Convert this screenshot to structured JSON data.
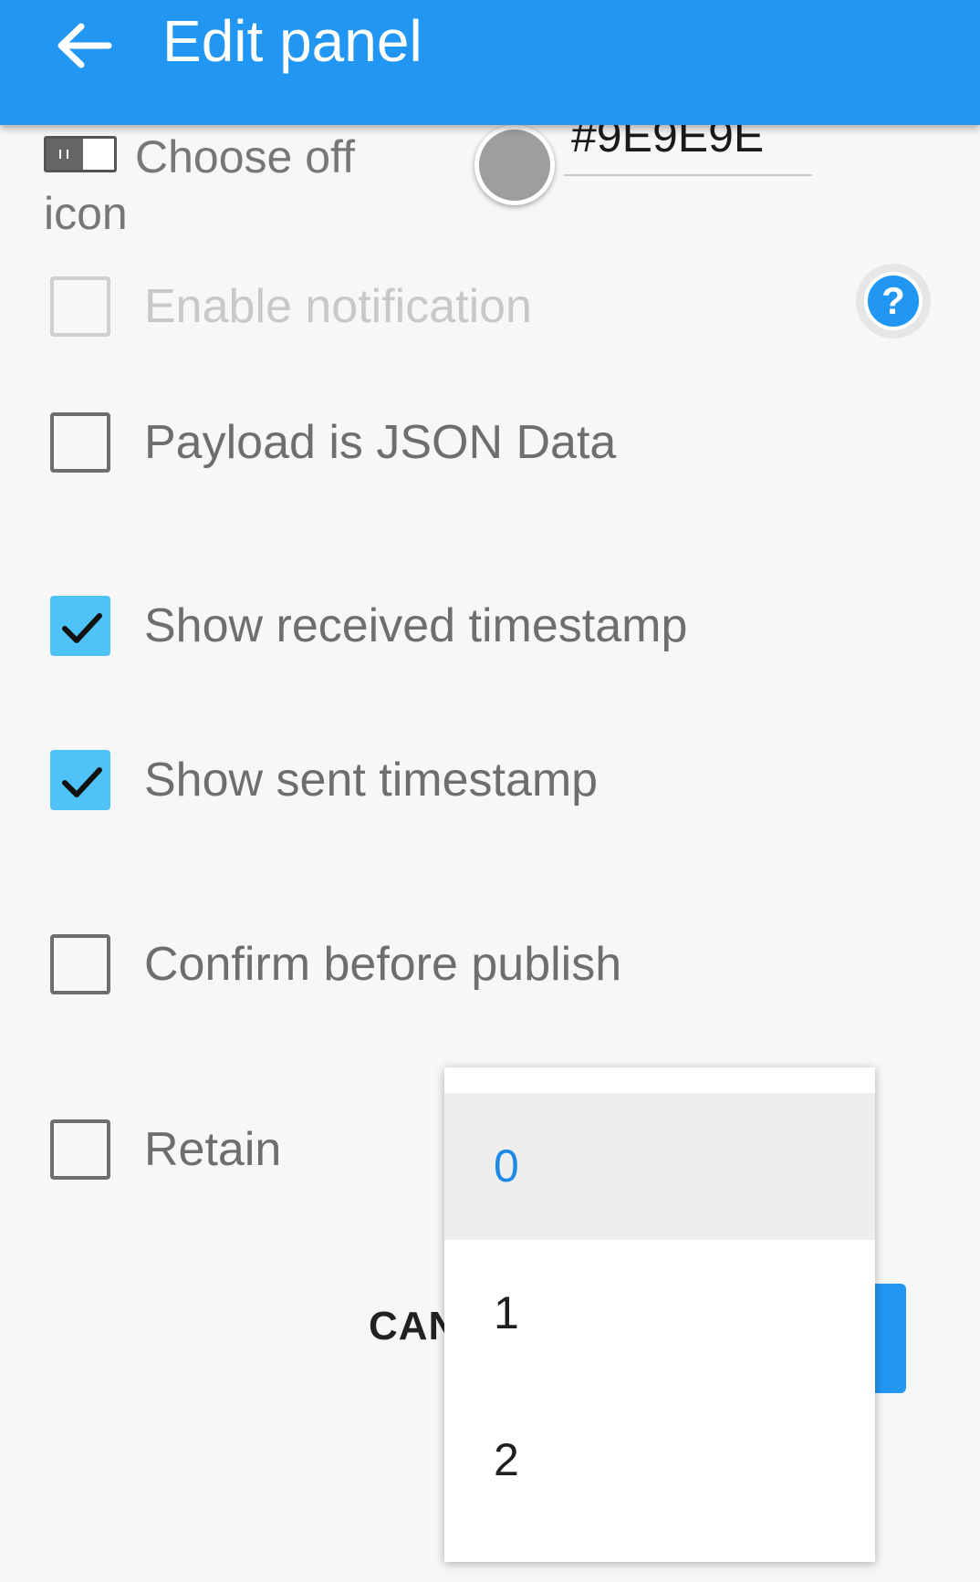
{
  "appbar": {
    "title": "Edit panel",
    "back_icon": "arrow-left-icon",
    "color": "#2196f3"
  },
  "off_icon": {
    "label": "Choose off icon",
    "color_hex": "#9E9E9E"
  },
  "checkboxes": [
    {
      "label": "Enable notification",
      "checked": false,
      "disabled": true
    },
    {
      "label": "Payload is JSON Data",
      "checked": false,
      "disabled": false
    },
    {
      "label": "Show received timestamp",
      "checked": true,
      "disabled": false
    },
    {
      "label": "Show sent timestamp",
      "checked": true,
      "disabled": false
    },
    {
      "label": "Confirm before publish",
      "checked": false,
      "disabled": false
    },
    {
      "label": "Retain",
      "checked": false,
      "disabled": false
    }
  ],
  "help_icon": "question-mark-icon",
  "actions": {
    "cancel_label": "CAN"
  },
  "dropdown": {
    "options": [
      "0",
      "1",
      "2"
    ],
    "selected": "0"
  },
  "colors": {
    "accent": "#2196f3",
    "checkbox_checked": "#4fc3f7",
    "selected_option": "#1e88e5"
  }
}
